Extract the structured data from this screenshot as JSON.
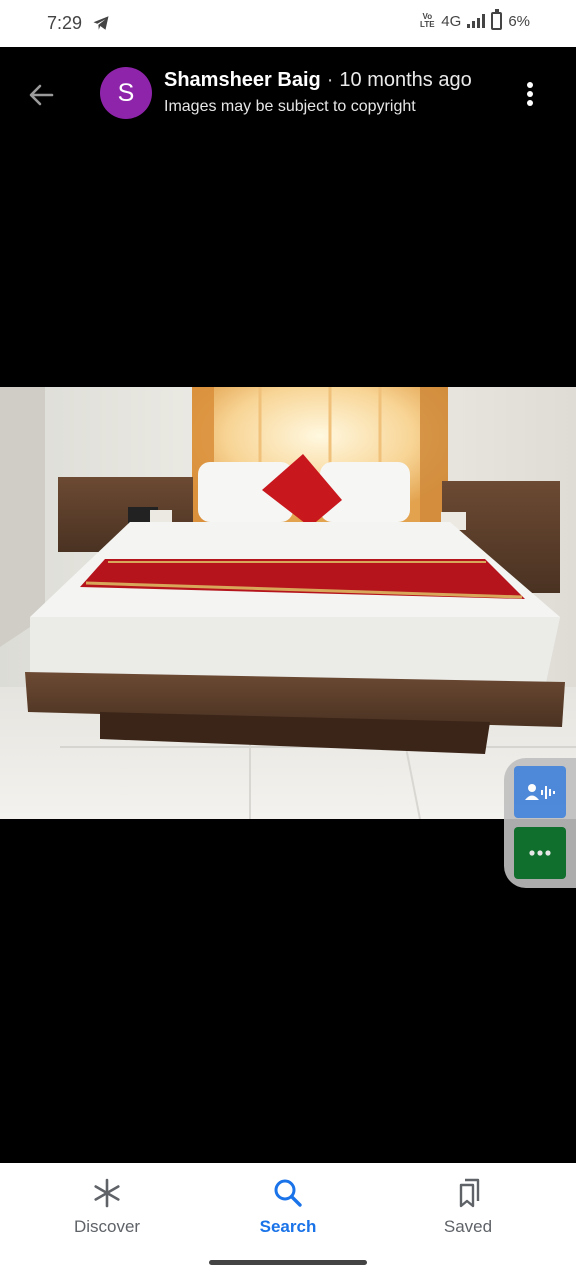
{
  "status_bar": {
    "time": "7:29",
    "network": "4G",
    "volte": "Vo LTE",
    "battery": "6%"
  },
  "header": {
    "avatar_letter": "S",
    "author": "Shamsheer Baig",
    "separator": "·",
    "posted": "10 months ago",
    "subtitle": "Images may be subject to copyright",
    "avatar_color": "#8e24aa"
  },
  "bottom_nav": {
    "items": [
      {
        "label": "Discover",
        "icon": "asterisk-icon",
        "active": false
      },
      {
        "label": "Search",
        "icon": "search-icon",
        "active": true
      },
      {
        "label": "Saved",
        "icon": "bookmarks-icon",
        "active": false
      }
    ],
    "active_color": "#1a73e8"
  },
  "side_buttons": [
    {
      "icon": "voice-search-icon",
      "color": "#3d7ed8"
    },
    {
      "icon": "more-horizontal-icon",
      "color": "#127c32"
    }
  ]
}
